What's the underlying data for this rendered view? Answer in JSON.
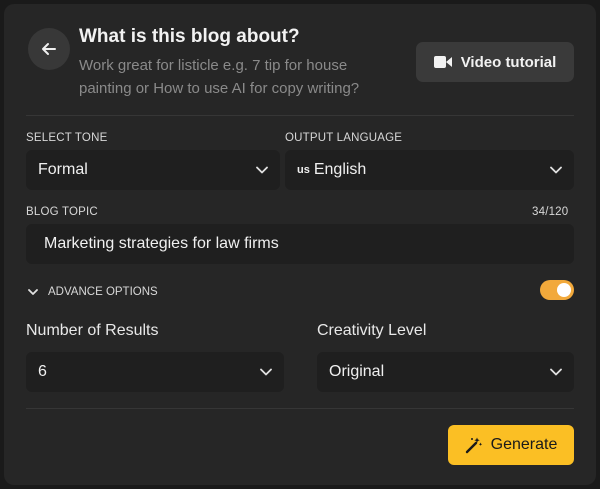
{
  "header": {
    "title": "What is this blog about?",
    "subtitle": "Work great for listicle e.g. 7 tip for house painting or How to use AI for copy writing?",
    "video_button_label": "Video tutorial"
  },
  "tone": {
    "label": "SELECT TONE",
    "value": "Formal"
  },
  "language": {
    "label": "OUTPUT LANGUAGE",
    "flag": "us",
    "value": "English"
  },
  "topic": {
    "label": "BLOG TOPIC",
    "counter": "34/120",
    "value": "Marketing strategies for law firms"
  },
  "advanced": {
    "label": "ADVANCE OPTIONS",
    "enabled": true
  },
  "results": {
    "label": "Number of Results",
    "value": "6"
  },
  "creativity": {
    "label": "Creativity Level",
    "value": "Original"
  },
  "generate_label": "Generate",
  "colors": {
    "accent": "#fbbf24",
    "toggle": "#f2a93b",
    "panel": "#262626",
    "field": "#1f1f1f"
  },
  "icons": [
    "arrow-left-icon",
    "video-camera-icon",
    "chevron-down-icon",
    "magic-wand-icon"
  ]
}
